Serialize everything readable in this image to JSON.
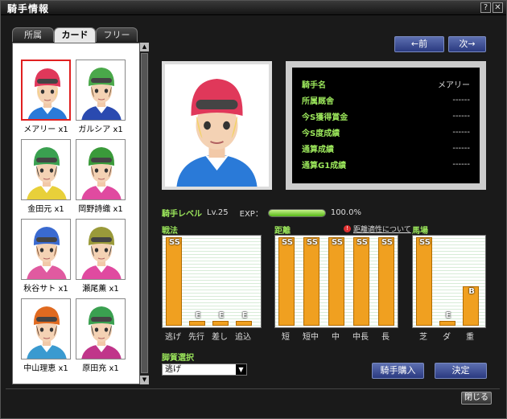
{
  "window": {
    "title": "騎手情報",
    "help_label": "?",
    "close_label": "✕"
  },
  "tabs": [
    "所属",
    "カード",
    "フリー"
  ],
  "jockeys": [
    {
      "name": "メアリー x1",
      "helmet": "#e0385a",
      "hair": "#f3d26a",
      "silks": "#2a7ad8"
    },
    {
      "name": "ガルシア x1",
      "helmet": "#4aa84a",
      "hair": "#6b4a2a",
      "silks": "#2a4ab0"
    },
    {
      "name": "金田元 x1",
      "helmet": "#3aa050",
      "hair": "#2a2a2a",
      "silks": "#e8d03a"
    },
    {
      "name": "岡野詩織 x1",
      "helmet": "#3a9a3a",
      "hair": "#5a3a2a",
      "silks": "#e04aa0"
    },
    {
      "name": "秋谷サト x1",
      "helmet": "#3a6ad0",
      "hair": "#6a3a1a",
      "silks": "#e05aa0"
    },
    {
      "name": "瀬尾薫 x1",
      "helmet": "#9a9a3a",
      "hair": "#2a2a2a",
      "silks": "#e04aa0"
    },
    {
      "name": "中山理恵 x1",
      "helmet": "#e06a20",
      "hair": "#4a2a1a",
      "silks": "#3a9ad0"
    },
    {
      "name": "原田充 x1",
      "helmet": "#3aa050",
      "hair": "#2a2a2a",
      "silks": "#c0358a"
    }
  ],
  "nav": {
    "prev": "←前",
    "next": "次→"
  },
  "info": [
    {
      "label": "騎手名",
      "value": "メアリー"
    },
    {
      "label": "所属厩舎",
      "value": "------"
    },
    {
      "label": "今S獲得賞金",
      "value": "------"
    },
    {
      "label": "今S度成績",
      "value": "------"
    },
    {
      "label": "通算成績",
      "value": "------"
    },
    {
      "label": "通算G1成績",
      "value": "------"
    }
  ],
  "level": {
    "label": "騎手レベル",
    "value": "Lv.25",
    "exp_label": "EXP：",
    "exp_percent": "100.0%",
    "exp_fraction": 1.0
  },
  "sections": {
    "tactics": {
      "title": "戦法",
      "items": [
        {
          "label": "逃げ",
          "grade": "SS",
          "level": 1.0
        },
        {
          "label": "先行",
          "grade": "E",
          "level": 0.03
        },
        {
          "label": "差し",
          "grade": "E",
          "level": 0.03
        },
        {
          "label": "追込",
          "grade": "E",
          "level": 0.03
        }
      ]
    },
    "distance": {
      "title": "距離",
      "link": "距離適性について",
      "items": [
        {
          "label": "短",
          "grade": "SS",
          "level": 1.0
        },
        {
          "label": "短中",
          "grade": "SS",
          "level": 1.0
        },
        {
          "label": "中",
          "grade": "SS",
          "level": 1.0
        },
        {
          "label": "中長",
          "grade": "SS",
          "level": 1.0
        },
        {
          "label": "長",
          "grade": "SS",
          "level": 1.0
        }
      ]
    },
    "track": {
      "title": "馬場",
      "items": [
        {
          "label": "芝",
          "grade": "SS",
          "level": 1.0
        },
        {
          "label": "ダ",
          "grade": "E",
          "level": 0.03
        },
        {
          "label": "重",
          "grade": "B",
          "level": 0.45
        }
      ]
    }
  },
  "aptitude": {
    "title": "脚質選択",
    "selected": "逃げ"
  },
  "buttons": {
    "buy": "騎手購入",
    "decide": "決定",
    "close": "閉じる"
  },
  "colors": {
    "accent_green": "#9be65b",
    "bar_orange": "#f0a020",
    "button_blue": "#3a4a95"
  }
}
